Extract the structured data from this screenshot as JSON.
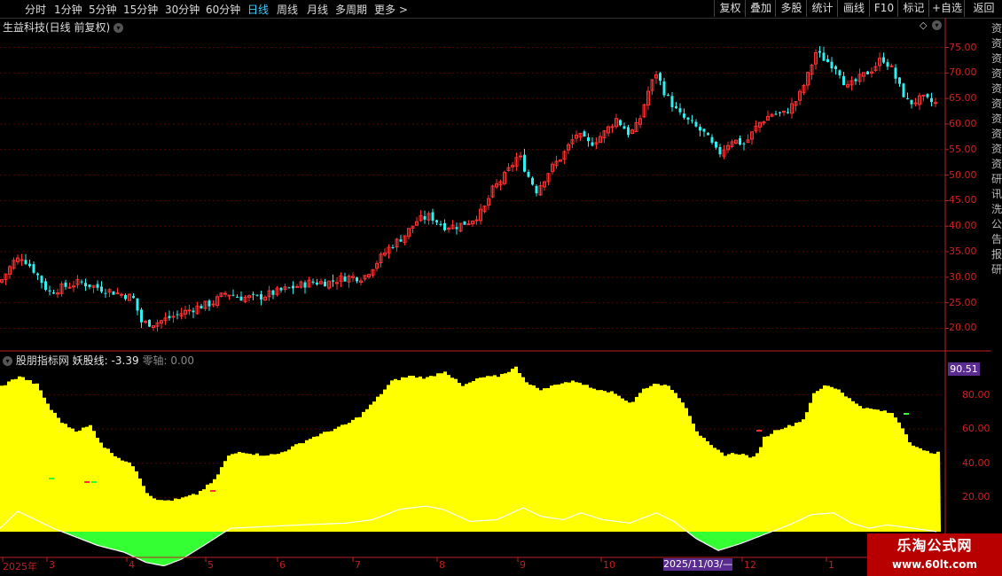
{
  "toolbar": {
    "periods": [
      {
        "label": "分时",
        "active": false
      },
      {
        "label": "1分钟",
        "active": false
      },
      {
        "label": "5分钟",
        "active": false
      },
      {
        "label": "15分钟",
        "active": false
      },
      {
        "label": "30分钟",
        "active": false
      },
      {
        "label": "60分钟",
        "active": false
      },
      {
        "label": "日线",
        "active": true
      },
      {
        "label": "周线",
        "active": false
      },
      {
        "label": "月线",
        "active": false
      },
      {
        "label": "多周期",
        "active": false
      },
      {
        "label": "更多 >",
        "active": false
      }
    ],
    "buttons": [
      "复权",
      "叠加",
      "多股",
      "统计",
      "画线",
      "F10",
      "标记",
      "+自选",
      "返回"
    ]
  },
  "chart_title": "生益科技(日线 前复权)",
  "indicator": {
    "name": "股朋指标网",
    "line_label": "妖股线:",
    "line_value": "-3.39",
    "zero_label": "零轴:",
    "zero_value": "0.00",
    "current_badge": "90.51"
  },
  "date_badge": "2025/11/03/—",
  "watermark": {
    "line1": "乐淘公式网",
    "line2": "www.60lt.com"
  },
  "right_column_text": "资资资资资资资资资资研讯洗公告报研",
  "colors": {
    "up": "#ff3030",
    "down": "#30f0f0",
    "fill": "#ffff00",
    "green": "#33ff33",
    "grid": "#5a0000",
    "axis": "#c02020"
  },
  "chart_data": [
    {
      "type": "candlestick",
      "title": "生益科技(日线 前复权)",
      "y_ticks": [
        "75.00",
        "70.00",
        "65.00",
        "60.00",
        "55.00",
        "50.00",
        "45.00",
        "40.00",
        "35.00",
        "30.00",
        "25.00",
        "20.00"
      ],
      "ylim": [
        18,
        77
      ],
      "x_ticks": [
        "2025年",
        "3",
        "4",
        "5",
        "6",
        "7",
        "8",
        "9",
        "10",
        "",
        "12",
        "1"
      ],
      "close_path": [
        [
          0,
          29
        ],
        [
          15,
          33
        ],
        [
          25,
          34
        ],
        [
          40,
          31
        ],
        [
          55,
          27
        ],
        [
          70,
          28
        ],
        [
          90,
          29
        ],
        [
          110,
          28
        ],
        [
          130,
          27
        ],
        [
          150,
          26
        ],
        [
          160,
          21
        ],
        [
          175,
          21
        ],
        [
          190,
          22
        ],
        [
          205,
          23
        ],
        [
          220,
          24
        ],
        [
          240,
          25
        ],
        [
          255,
          27
        ],
        [
          270,
          26
        ],
        [
          290,
          26
        ],
        [
          310,
          27
        ],
        [
          330,
          28
        ],
        [
          350,
          29
        ],
        [
          370,
          29
        ],
        [
          390,
          30
        ],
        [
          410,
          30
        ],
        [
          425,
          33
        ],
        [
          440,
          36
        ],
        [
          455,
          38
        ],
        [
          470,
          41
        ],
        [
          485,
          42
        ],
        [
          500,
          40
        ],
        [
          515,
          40
        ],
        [
          530,
          41
        ],
        [
          545,
          43
        ],
        [
          555,
          47
        ],
        [
          570,
          50
        ],
        [
          585,
          54
        ],
        [
          595,
          50
        ],
        [
          605,
          47
        ],
        [
          620,
          51
        ],
        [
          635,
          54
        ],
        [
          650,
          58
        ],
        [
          665,
          56
        ],
        [
          680,
          58
        ],
        [
          695,
          61
        ],
        [
          710,
          58
        ],
        [
          720,
          60
        ],
        [
          730,
          66
        ],
        [
          740,
          70
        ],
        [
          750,
          66
        ],
        [
          765,
          62
        ],
        [
          780,
          60
        ],
        [
          795,
          58
        ],
        [
          810,
          54
        ],
        [
          825,
          57
        ],
        [
          840,
          56
        ],
        [
          855,
          60
        ],
        [
          870,
          62
        ],
        [
          885,
          62
        ],
        [
          900,
          65
        ],
        [
          910,
          69
        ],
        [
          920,
          74
        ],
        [
          935,
          72
        ],
        [
          945,
          71
        ],
        [
          955,
          67
        ],
        [
          970,
          69
        ],
        [
          985,
          71
        ],
        [
          995,
          73
        ],
        [
          1005,
          71
        ],
        [
          1015,
          67
        ],
        [
          1025,
          64
        ],
        [
          1040,
          65
        ],
        [
          1055,
          64
        ]
      ]
    },
    {
      "type": "area",
      "title": "股朋指标网",
      "y_ticks": [
        "80.00",
        "60.00",
        "40.00",
        "20.00"
      ],
      "ylim": [
        0,
        100
      ],
      "series": [
        {
          "name": "妖股线",
          "values_path": [
            [
              0,
              85
            ],
            [
              20,
              91
            ],
            [
              40,
              86
            ],
            [
              55,
              72
            ],
            [
              70,
              63
            ],
            [
              85,
              59
            ],
            [
              100,
              62
            ],
            [
              115,
              50
            ],
            [
              130,
              44
            ],
            [
              150,
              38
            ],
            [
              165,
              22
            ],
            [
              180,
              18
            ],
            [
              200,
              19
            ],
            [
              220,
              22
            ],
            [
              240,
              30
            ],
            [
              255,
              44
            ],
            [
              270,
              47
            ],
            [
              290,
              45
            ],
            [
              310,
              45
            ],
            [
              330,
              50
            ],
            [
              350,
              55
            ],
            [
              370,
              59
            ],
            [
              390,
              63
            ],
            [
              405,
              68
            ],
            [
              420,
              76
            ],
            [
              440,
              88
            ],
            [
              460,
              91
            ],
            [
              480,
              90
            ],
            [
              500,
              94
            ],
            [
              520,
              85
            ],
            [
              540,
              90
            ],
            [
              560,
              91
            ],
            [
              580,
              96
            ],
            [
              595,
              86
            ],
            [
              610,
              83
            ],
            [
              630,
              87
            ],
            [
              650,
              88
            ],
            [
              665,
              84
            ],
            [
              680,
              83
            ],
            [
              695,
              80
            ],
            [
              710,
              75
            ],
            [
              725,
              84
            ],
            [
              740,
              87
            ],
            [
              755,
              84
            ],
            [
              770,
              75
            ],
            [
              785,
              58
            ],
            [
              800,
              50
            ],
            [
              815,
              45
            ],
            [
              830,
              46
            ],
            [
              850,
              43
            ],
            [
              860,
              55
            ],
            [
              875,
              60
            ],
            [
              890,
              62
            ],
            [
              905,
              66
            ],
            [
              915,
              80
            ],
            [
              930,
              86
            ],
            [
              945,
              83
            ],
            [
              960,
              76
            ],
            [
              975,
              72
            ],
            [
              990,
              71
            ],
            [
              1005,
              69
            ],
            [
              1015,
              62
            ],
            [
              1025,
              52
            ],
            [
              1040,
              47
            ],
            [
              1057,
              46
            ]
          ]
        },
        {
          "name": "white line",
          "values_path": [
            [
              0,
              2
            ],
            [
              20,
              12
            ],
            [
              40,
              7
            ],
            [
              60,
              2
            ],
            [
              80,
              -2
            ],
            [
              110,
              -8
            ],
            [
              140,
              -12
            ],
            [
              165,
              -18
            ],
            [
              185,
              -20
            ],
            [
              205,
              -16
            ],
            [
              230,
              -8
            ],
            [
              260,
              2
            ],
            [
              300,
              3
            ],
            [
              340,
              4
            ],
            [
              390,
              5
            ],
            [
              420,
              7
            ],
            [
              450,
              13
            ],
            [
              480,
              15
            ],
            [
              500,
              13
            ],
            [
              530,
              6
            ],
            [
              560,
              7
            ],
            [
              590,
              14
            ],
            [
              610,
              9
            ],
            [
              635,
              7
            ],
            [
              655,
              11
            ],
            [
              680,
              7
            ],
            [
              710,
              5
            ],
            [
              740,
              11
            ],
            [
              760,
              6
            ],
            [
              785,
              -4
            ],
            [
              810,
              -11
            ],
            [
              835,
              -7
            ],
            [
              860,
              -2
            ],
            [
              890,
              4
            ],
            [
              915,
              10
            ],
            [
              940,
              11
            ],
            [
              960,
              5
            ],
            [
              980,
              2
            ],
            [
              1000,
              4
            ],
            [
              1030,
              2
            ],
            [
              1057,
              0
            ]
          ]
        }
      ]
    }
  ]
}
